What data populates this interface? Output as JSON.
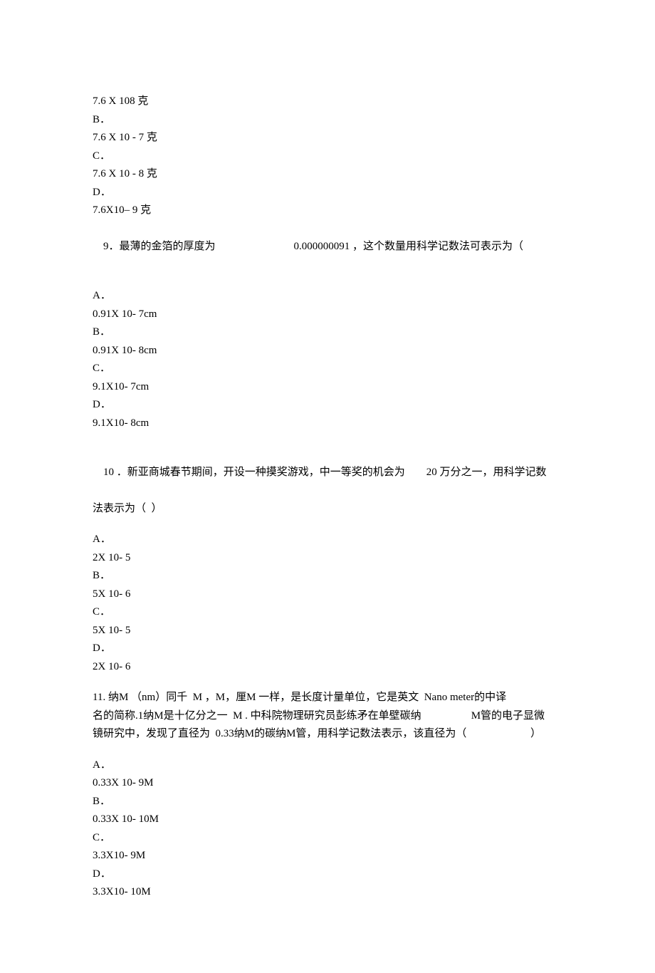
{
  "q8_options": {
    "a_text": "7.6 X 108 克",
    "b_label": "B．",
    "b_text": "7.6 X 10 - 7 克",
    "c_label": "C．",
    "c_text": "7.6 X 10 - 8 克",
    "d_label": "D．",
    "d_text": "7.6X10– 9 克"
  },
  "q9": {
    "num": "9．",
    "text_a": "最薄的金箔的厚度为",
    "text_b": "0.000000091 ，这个数量用科学记数法可表示为（",
    "a_label": "A．",
    "a_text": "0.91X 10- 7cm",
    "b_label": "B．",
    "b_text": "0.91X 10- 8cm",
    "c_label": "C．",
    "c_text": "9.1X10- 7cm",
    "d_label": "D．",
    "d_text": "9.1X10- 8cm"
  },
  "q10": {
    "line1_a": "10 ．新亚商城春节期间，开设一种摸奖游戏，中一等奖的机会为",
    "line1_b": "20 万分之一，用科学记数",
    "line2": "法表示为（  ）",
    "a_label": "A．",
    "a_text": "2X 10- 5",
    "b_label": "B．",
    "b_text": "5X 10- 6",
    "c_label": "C．",
    "c_text": "5X 10- 5",
    "d_label": "D．",
    "d_text": "2X 10- 6"
  },
  "q11": {
    "line1_a": "11. 纳M （nm）同千  M ，M，厘M 一样，是长度计量单位，它是英文  Nano meter的中译",
    "line2_a": "名的简称.1纳M是十亿分之一  M . 中科院物理研究员彭练矛在单壁碳纳",
    "line2_b": "M管的电子显微",
    "line3_a": "镜研究中，发现了直径为  0.33纳M的碳纳M管，用科学记数法表示，该直径为（",
    "line3_b": "）",
    "a_label": "A．",
    "a_text": "0.33X 10- 9M",
    "b_label": "B．",
    "b_text": "0.33X 10- 10M",
    "c_label": "C．",
    "c_text": "3.3X10- 9M",
    "d_label": "D．",
    "d_text": "3.3X10- 10M"
  }
}
